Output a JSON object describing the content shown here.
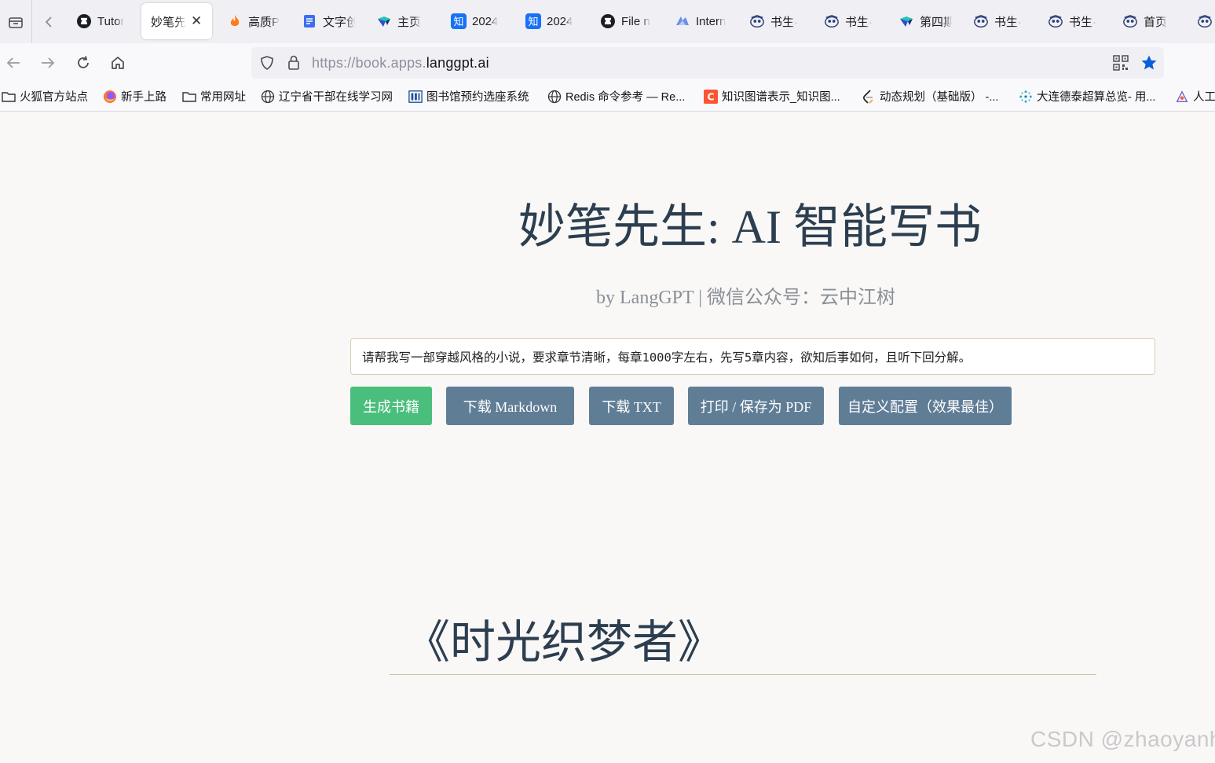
{
  "browser": {
    "tabs": [
      {
        "label": "Tutor",
        "icon": "github-icon"
      },
      {
        "label": "妙笔先",
        "icon": "none",
        "active": true
      },
      {
        "label": "高质P",
        "icon": "flame-icon"
      },
      {
        "label": "文字创",
        "icon": "doc-icon"
      },
      {
        "label": "主页",
        "icon": "bird-icon"
      },
      {
        "label": "2024",
        "icon": "zhihu-icon"
      },
      {
        "label": "2024",
        "icon": "zhihu-icon"
      },
      {
        "label": "File n",
        "icon": "github-icon"
      },
      {
        "label": "Intern",
        "icon": "intern-icon"
      },
      {
        "label": "书生·",
        "icon": "owl-icon"
      },
      {
        "label": "书生·",
        "icon": "owl-icon"
      },
      {
        "label": "第四期",
        "icon": "bird-icon"
      },
      {
        "label": "书生·",
        "icon": "owl-icon"
      },
      {
        "label": "书生·",
        "icon": "owl-icon"
      },
      {
        "label": "首页",
        "icon": "owl-icon"
      }
    ],
    "url_prefix": "https://book.apps.",
    "url_domain": "langgpt.ai",
    "bookmarks": [
      {
        "label": "火狐官方站点",
        "icon": "folder-icon"
      },
      {
        "label": "新手上路",
        "icon": "firefox-icon"
      },
      {
        "label": "常用网址",
        "icon": "folder-icon"
      },
      {
        "label": "辽宁省干部在线学习网",
        "icon": "globe-icon"
      },
      {
        "label": "图书馆预约选座系统",
        "icon": "library-icon"
      },
      {
        "label": "Redis 命令参考 — Re...",
        "icon": "globe-icon"
      },
      {
        "label": "知识图谱表示_知识图...",
        "icon": "csdn-icon"
      },
      {
        "label": "动态规划（基础版） -...",
        "icon": "leetcode-icon"
      },
      {
        "label": "大连德泰超算总览- 用...",
        "icon": "dots-icon"
      },
      {
        "label": "人工",
        "icon": "ai-icon"
      }
    ]
  },
  "page": {
    "title": "妙笔先生: AI 智能写书",
    "subtitle": "by LangGPT | 微信公众号：云中江树",
    "prompt_value": "请帮我写一部穿越风格的小说，要求章节清晰，每章1000字左右，先写5章内容，欲知后事如何，且听下回分解。",
    "buttons": {
      "generate": "生成书籍",
      "download_md": "下载 Markdown",
      "download_txt": "下载 TXT",
      "print_pdf": "打印 / 保存为 PDF",
      "custom_config": "自定义配置（效果最佳）"
    },
    "book_title": "《时光织梦者》"
  },
  "watermark": "CSDN @zhaoyanh",
  "colors": {
    "green_button": "#4abe7d",
    "slate_button": "#607d96",
    "title_text": "#2c3e50",
    "page_bg": "#f9f8f6"
  }
}
